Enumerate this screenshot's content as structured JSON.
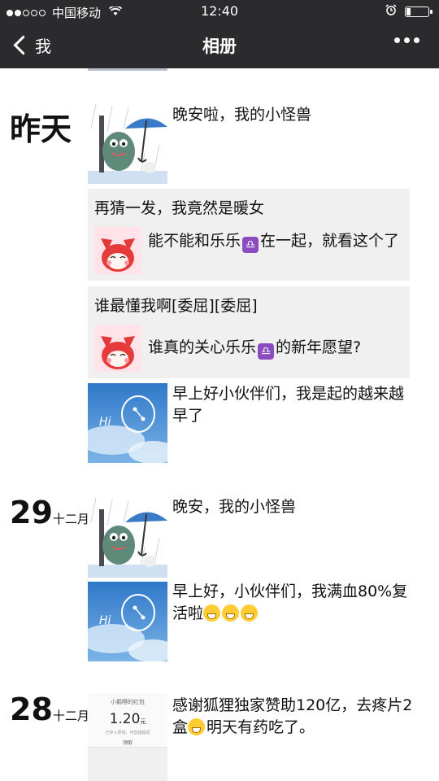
{
  "status_bar": {
    "carrier": "中国移动",
    "time": "12:40",
    "battery_level": 0.2
  },
  "nav": {
    "back_label": "我",
    "title": "相册"
  },
  "sections": [
    {
      "date_main": "昨天",
      "date_sub": "",
      "posts": [
        {
          "type": "image",
          "image": "cartoon-monster-umbrella",
          "text": "晚安啦，我的小怪兽"
        },
        {
          "type": "share",
          "caption": "再猜一发，我竟然是暖女",
          "thumb": "red-fox-cartoon",
          "title_before": "能不能和乐乐",
          "emoji": "libra-emoji",
          "title_after": "在一起，就看这个了"
        },
        {
          "type": "share",
          "caption": "谁最懂我啊[委屈][委屈]",
          "thumb": "red-fox-cartoon",
          "title_before": "谁真的关心乐乐",
          "emoji": "libra-emoji",
          "title_after": "的新年愿望?"
        },
        {
          "type": "image",
          "image": "sky-hi-cloud",
          "text": "早上好小伙伴们，我是起的越来越早了"
        }
      ]
    },
    {
      "date_main": "29",
      "date_sub": "十二月",
      "posts": [
        {
          "type": "image",
          "image": "cartoon-monster-umbrella",
          "text": "晚安，我的小怪兽"
        },
        {
          "type": "image",
          "image": "sky-hi-cloud",
          "text": "早上好，小伙伴们，我满血80%复活啦",
          "emoji": "grin-emoji",
          "emoji_count": 3
        }
      ]
    },
    {
      "date_main": "28",
      "date_sub": "十二月",
      "posts": [
        {
          "type": "image",
          "image": "red-packet-screenshot",
          "text_before": "感谢狐狸独家赞助120亿，去疼片2盒",
          "emoji": "crying-laugh-emoji",
          "text_after": "明天有药吃了。",
          "image_texts": {
            "header": "小鹅嘢的红包",
            "amount": "1.20",
            "unit": "元",
            "note": "已存入零钱，可直接提现",
            "footer": "领取"
          }
        }
      ]
    }
  ],
  "colors": {
    "bar": "#2b2b2d",
    "share_bg": "#f0f0f0",
    "libra": "#8b4cc2",
    "sky": "#4a8fd6"
  }
}
